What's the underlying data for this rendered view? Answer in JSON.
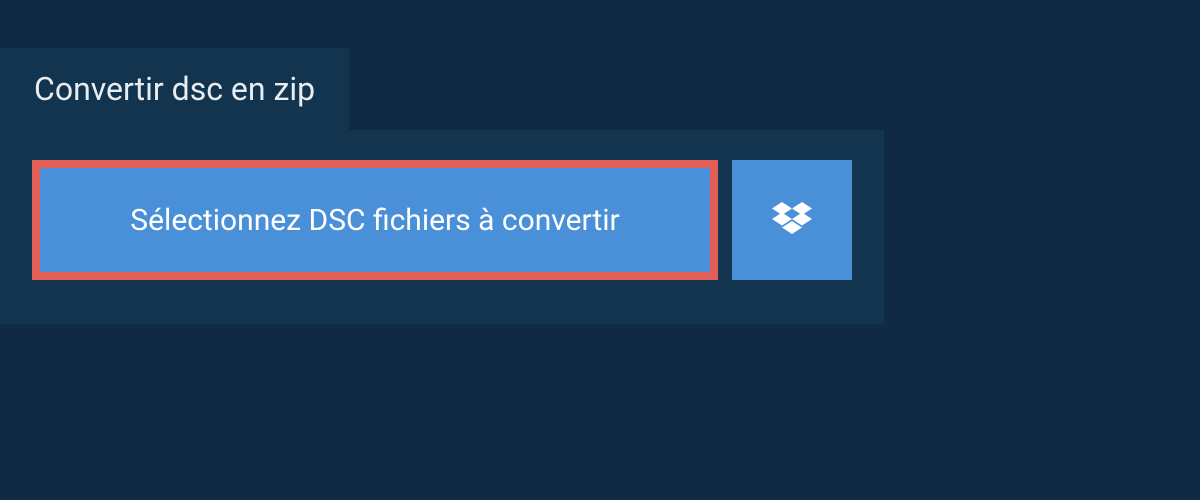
{
  "header": {
    "title": "Convertir dsc en zip"
  },
  "actions": {
    "select_label": "Sélectionnez DSC fichiers à convertir"
  },
  "colors": {
    "page_bg": "#0f2a42",
    "panel_bg": "#12344e",
    "button_bg": "#4a90d9",
    "highlight_border": "#e15f56",
    "text_light": "#ffffff"
  }
}
